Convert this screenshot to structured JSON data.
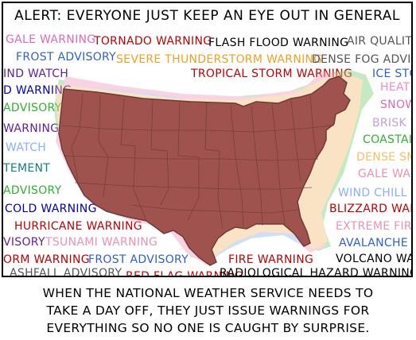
{
  "title": "ALERT: EVERYONE JUST KEEP AN EYE OUT IN GENERAL",
  "caption": [
    "WHEN THE NATIONAL WEATHER SERVICE NEEDS TO",
    "TAKE A DAY OFF, THEY JUST ISSUE WARNINGS FOR",
    "EVERYTHING SO NO ONE IS CAUGHT BY SURPRISE."
  ],
  "warnings": {
    "gale_warning_1": "GALE WARNING",
    "tornado_warning": "TORNADO WARNING",
    "flash_flood_warning": "FLASH FLOOD WARNING",
    "air_quality": "AIR QUALITY",
    "frost_advisory_1": "FROST ADVISORY",
    "severe_thunderstorm_warning": "SEVERE THUNDERSTORM WARNING",
    "dense_fog_advisory": "DENSE FOG ADVISOR",
    "wind_watch": "IND WATCH",
    "tropical_storm_warning": "TROPICAL STORM WARNING",
    "ice_storm": "ICE STOR",
    "d_warning": "D WARNING",
    "heat": "HEAT A",
    "advisory_1": "ADVISORY",
    "snow": "SNOW",
    "warning_1": "WARNING",
    "brisk_wind": "BRISK W",
    "watch_1": "WATCH",
    "coastal_flood": "COASTAL FL",
    "dense_smoke": "DENSE SMO",
    "statement": "TEMENT",
    "gale_warning_2": "GALE WARN",
    "advisory_2": "ADVISORY",
    "wind_chill": "WIND CHILL AD",
    "cold_warning": "COLD WARNING",
    "blizzard_warning": "BLIZZARD WARN",
    "hurricane_warning": "HURRICANE WARNING",
    "extreme_fire": "EXTREME FIRE",
    "visory": "VISORY",
    "tsunami_warning": "TSUNAMI WARNING",
    "avalanche_warning": "AVALANCHE W",
    "storm_warning": "ORM WARNING",
    "frost_advisory_2": "FROST ADVISORY",
    "fire_warning": "FIRE WARNING",
    "volcano_warning": "VOLCANO WAR",
    "ashfall_advisory": "ASHFALL ADVISORY",
    "red_flag_warning": "RED FLAG WARNING",
    "radiological_hazard_warning": "RADIOLOGICAL HAZARD WARNING"
  },
  "colors": {
    "map_fill": "#a0524e",
    "ink": "#000000",
    "pink": "#e06ab3",
    "red": "#c00000",
    "blue": "#2f5fcf",
    "gray": "#555555",
    "orange": "#f0a020",
    "purple": "#6020a0",
    "green": "#30b030",
    "light_blue": "#88b0ff",
    "light_orange": "#f2c060",
    "light_pink": "#f090b0",
    "light_purple": "#c0a0e0",
    "dark_blue": "#0000c0",
    "teal": "#108080"
  }
}
